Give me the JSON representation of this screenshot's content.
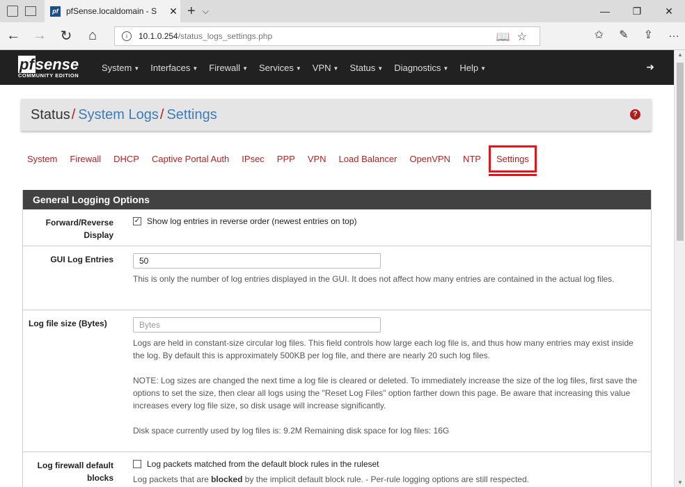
{
  "browser": {
    "tab_title": "pfSense.localdomain - S",
    "favicon_text": "pf",
    "url_host": "10.1.0.254",
    "url_path": "/status_logs_settings.php"
  },
  "navbar": {
    "logo_main": "sense",
    "logo_pf": "pf",
    "logo_sub": "COMMUNITY EDITION",
    "menu": [
      "System",
      "Interfaces",
      "Firewall",
      "Services",
      "VPN",
      "Status",
      "Diagnostics",
      "Help"
    ]
  },
  "breadcrumb": {
    "root": "Status",
    "section": "System Logs",
    "page": "Settings"
  },
  "subtabs": [
    "System",
    "Firewall",
    "DHCP",
    "Captive Portal Auth",
    "IPsec",
    "PPP",
    "VPN",
    "Load Balancer",
    "OpenVPN",
    "NTP",
    "Settings"
  ],
  "active_subtab": "Settings",
  "panel": {
    "title": "General Logging Options",
    "rows": {
      "reverse": {
        "label": "Forward/Reverse Display",
        "checked": true,
        "check_label": "Show log entries in reverse order (newest entries on top)"
      },
      "gui_entries": {
        "label": "GUI Log Entries",
        "value": "50",
        "help": "This is only the number of log entries displayed in the GUI. It does not affect how many entries are contained in the actual log files."
      },
      "file_size": {
        "label": "Log file size (Bytes)",
        "placeholder": "Bytes",
        "help1": "Logs are held in constant-size circular log files. This field controls how large each log file is, and thus how many entries may exist inside the log. By default this is approximately 500KB per log file, and there are nearly 20 such log files.",
        "help2": "NOTE: Log sizes are changed the next time a log file is cleared or deleted. To immediately increase the size of the log files, first save the options to set the size, then clear all logs using the \"Reset Log Files\" option farther down this page. Be aware that increasing this value increases every log file size, so disk usage will increase significantly.",
        "help3": "Disk space currently used by log files is: 9.2M Remaining disk space for log files: 16G"
      },
      "fw_default": {
        "label": "Log firewall default blocks",
        "checked": false,
        "check_label": "Log packets matched from the default block rules in the ruleset",
        "help_pre": "Log packets that are ",
        "help_bold": "blocked",
        "help_post": " by the implicit default block rule. - Per-rule logging options are still respected."
      }
    }
  },
  "colors": {
    "accent": "#b22222",
    "link": "#3d7cb8",
    "navbar": "#212121",
    "panel_head": "#424242",
    "highlight": "#e0151d"
  }
}
